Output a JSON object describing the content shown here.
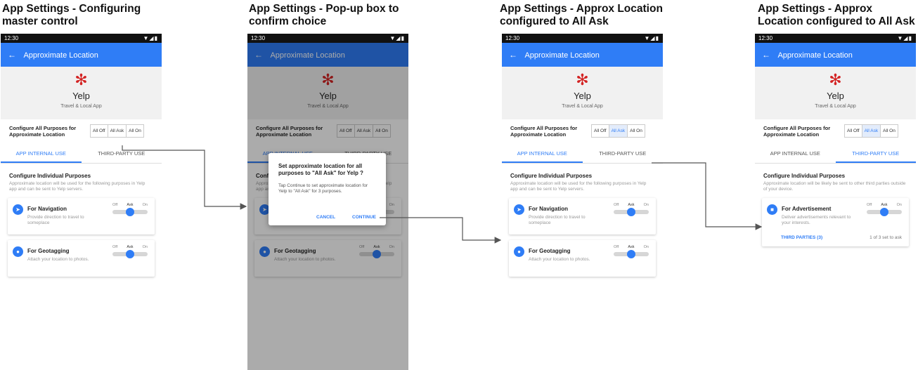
{
  "panel_titles": [
    "App Settings - Configuring master control",
    "App Settings - Pop-up box to confirm choice",
    "App Settings - Approx Location configured to All Ask",
    "App Settings - Approx Location configured to All Ask"
  ],
  "status": {
    "time": "12:30",
    "icons": "▼◢▮"
  },
  "appbar": {
    "back": "←",
    "title": "Approximate Location"
  },
  "app": {
    "logo": "✻",
    "name": "Yelp",
    "category": "Travel & Local App"
  },
  "configure": {
    "label": "Configure All Purposes for Approximate Location",
    "options": [
      "All Off",
      "All Ask",
      "All On"
    ]
  },
  "tabs": [
    "APP INTERNAL USE",
    "THIRD-PARTY USE"
  ],
  "individual": {
    "title": "Configure Individual Purposes",
    "internal_desc": "Approximate location will be used for the following purposes in Yelp app and can be sent to Yelp servers.",
    "thirdparty_desc": "Approximate location will be likely be sent to other third parties outside of your device."
  },
  "toggle_labels": [
    "Off",
    "Ask",
    "On"
  ],
  "purposes": [
    {
      "title": "For Navigation",
      "desc": "Provide direction to travel to someplace",
      "icon": "➤"
    },
    {
      "title": "For Geotagging",
      "desc": "Attach your location to photos.",
      "icon": "●"
    }
  ],
  "ad_purpose": {
    "title": "For Advertisement",
    "desc": "Deliver advertisements relevant to your interests.",
    "icon": "■",
    "link": "THIRD PARTIES (3)",
    "count": "1 of 3 set to ask"
  },
  "dialog": {
    "title": "Set approximate location for all purposes to \"All Ask\" for Yelp ?",
    "body": "Tap Continue to set approximate location for Yelp to \"All Ask\" for 3 purposes.",
    "cancel": "CANCEL",
    "continue": "CONTINUE"
  },
  "colors": {
    "accent": "#2f7df6",
    "yelp": "#d32323"
  }
}
